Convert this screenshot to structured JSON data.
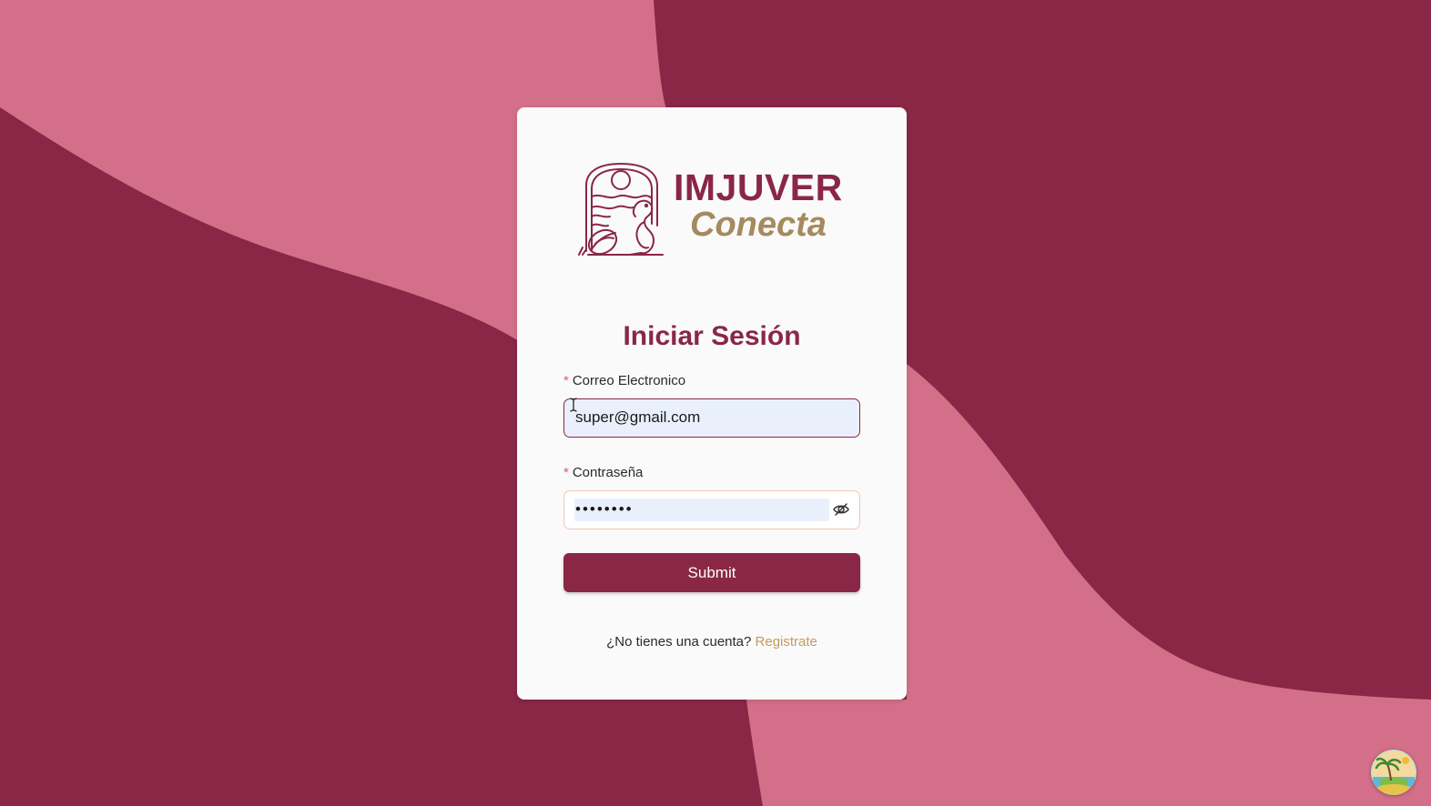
{
  "colors": {
    "background_dark": "#8a2746",
    "background_light": "#d46f89",
    "brand": "#8a2746",
    "accent_gold": "#a58a5f",
    "link": "#c59a5e",
    "required_marker": "#e05a6a"
  },
  "logo": {
    "title": "IMJUVER",
    "subtitle": "Conecta",
    "emblem_icon": "seahorse-emblem-icon"
  },
  "form": {
    "heading": "Iniciar Sesión",
    "required_marker": "*",
    "email": {
      "label": "Correo Electronico",
      "value": "super@gmail.com"
    },
    "password": {
      "label": "Contraseña",
      "value": "••••••••",
      "toggle_icon": "eye-slash-icon"
    },
    "submit_label": "Submit"
  },
  "signup": {
    "prompt": "¿No tienes una cuenta?",
    "link_label": "Registrate"
  },
  "corner_badge": {
    "icon": "palm-island-icon"
  }
}
